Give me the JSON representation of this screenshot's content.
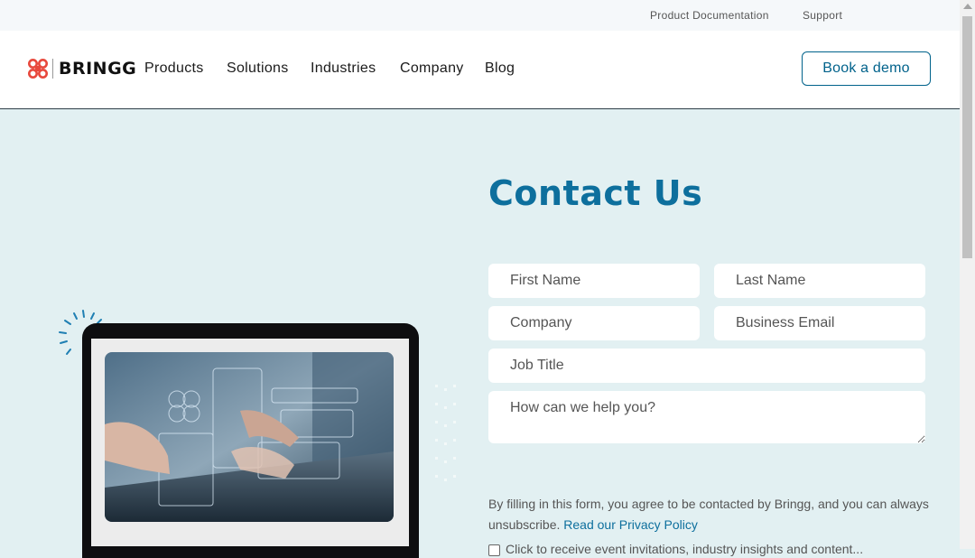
{
  "topbar": {
    "links": [
      "Product Documentation",
      "Support"
    ]
  },
  "header": {
    "logo_text": "BRINGG",
    "nav": [
      "Products",
      "Solutions",
      "Industries",
      "Company",
      "Blog"
    ],
    "cta": "Book a demo"
  },
  "main": {
    "title": "Contact Us",
    "form": {
      "first_name": "First Name",
      "last_name": "Last Name",
      "company": "Company",
      "email": "Business Email",
      "job_title": "Job Title",
      "message": "How can we help you?"
    },
    "consent_text": "By filling in this form, you agree to be contacted by Bringg, and you can always unsubscribe.",
    "privacy_link": "Read our Privacy Policy",
    "checkbox_label": "Click to receive event invitations, industry insights and content..."
  },
  "colors": {
    "brand": "#0d6f9d",
    "logo": "#e8493d",
    "background": "#e2f0f2"
  }
}
